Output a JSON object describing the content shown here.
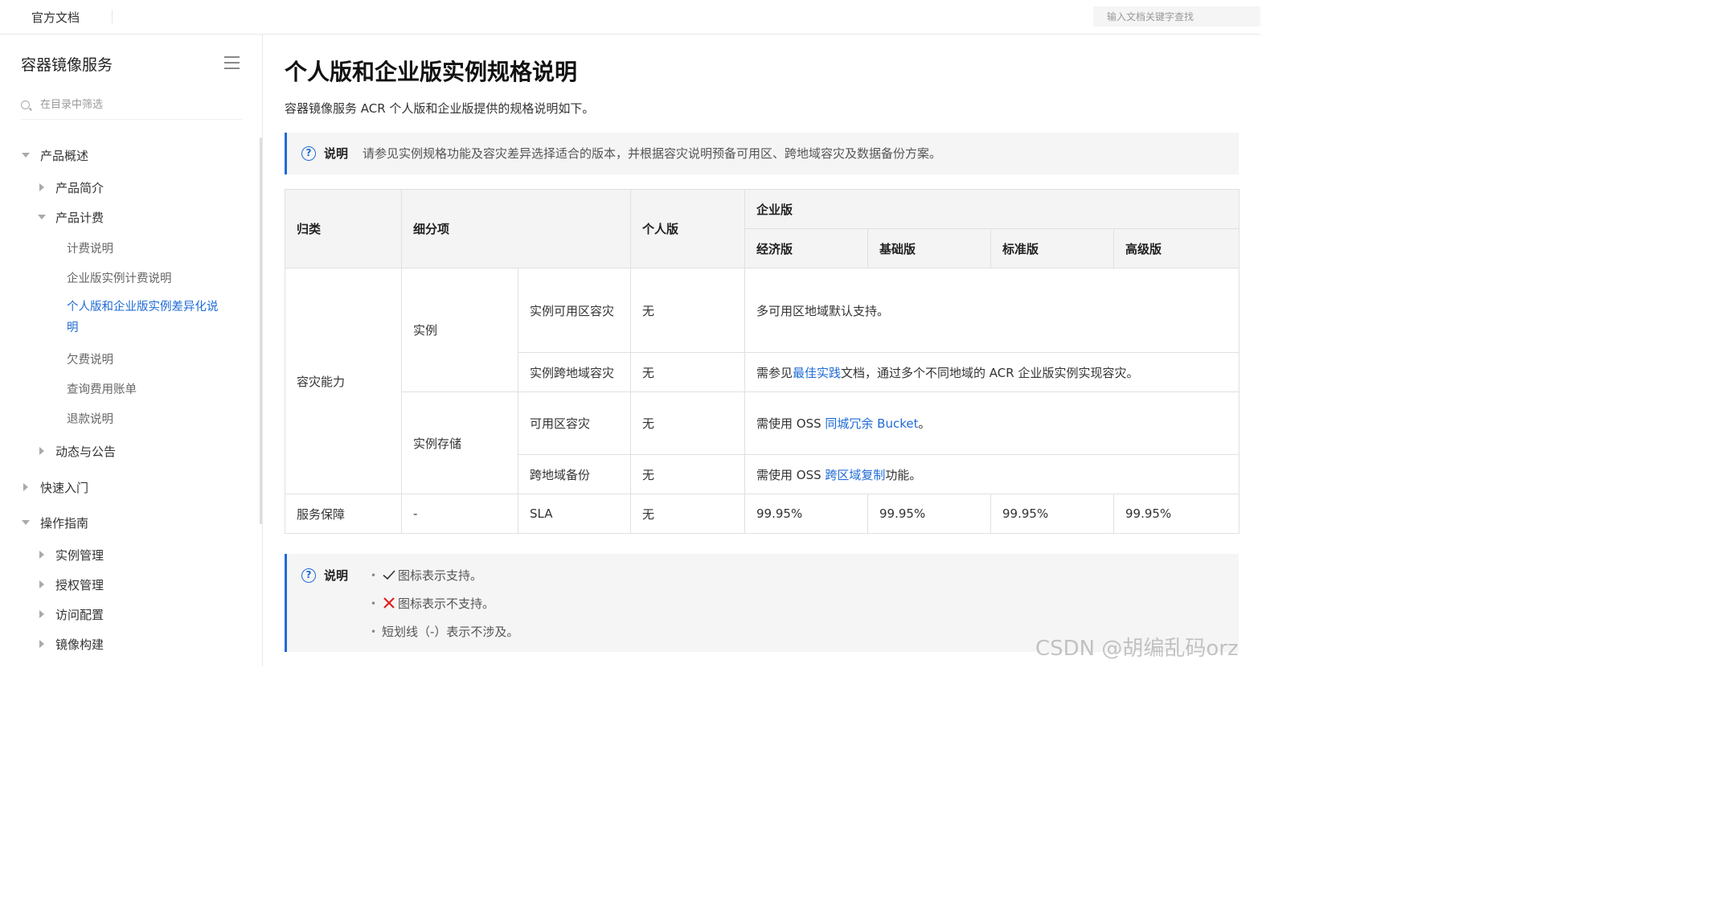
{
  "header": {
    "brand": "官方文档",
    "search_placeholder": "输入文档关键字查找"
  },
  "sidebar": {
    "title": "容器镜像服务",
    "filter_placeholder": "在目录中筛选",
    "items": [
      {
        "label": "产品概述"
      },
      {
        "label": "产品简介"
      },
      {
        "label": "产品计费"
      },
      {
        "label": "计费说明"
      },
      {
        "label": "企业版实例计费说明"
      },
      {
        "label": "个人版和企业版实例差异化说明"
      },
      {
        "label": "欠费说明"
      },
      {
        "label": "查询费用账单"
      },
      {
        "label": "退款说明"
      },
      {
        "label": "动态与公告"
      },
      {
        "label": "快速入门"
      },
      {
        "label": "操作指南"
      },
      {
        "label": "实例管理"
      },
      {
        "label": "授权管理"
      },
      {
        "label": "访问配置"
      },
      {
        "label": "镜像构建"
      }
    ]
  },
  "main": {
    "title": "个人版和企业版实例规格说明",
    "intro": "容器镜像服务 ACR 个人版和企业版提供的规格说明如下。",
    "note1": {
      "label": "说明",
      "text": "请参见实例规格功能及容灾差异选择适合的版本，并根据容灾说明预备可用区、跨地域容灾及数据备份方案。"
    },
    "table": {
      "headers": {
        "category": "归类",
        "subitem": "细分项",
        "personal": "个人版",
        "enterprise": "企业版",
        "economy": "经济版",
        "basic": "基础版",
        "standard": "标准版",
        "advanced": "高级版"
      },
      "rows": {
        "dr": "容灾能力",
        "instance": "实例",
        "az_dr": "实例可用区容灾",
        "az_dr_personal": "无",
        "az_dr_enterprise": "多可用区地域默认支持。",
        "region_dr": "实例跨地域容灾",
        "region_dr_personal": "无",
        "region_dr_pre": "需参见",
        "region_dr_link": "最佳实践",
        "region_dr_post": "文档，通过多个不同地域的 ACR 企业版实例实现容灾。",
        "storage": "实例存储",
        "storage_az": "可用区容灾",
        "storage_az_personal": "无",
        "storage_az_pre": "需使用 OSS ",
        "storage_az_link": "同城冗余 Bucket",
        "storage_az_post": "。",
        "storage_region": "跨地域备份",
        "storage_region_personal": "无",
        "storage_region_pre": "需使用 OSS ",
        "storage_region_link": "跨区域复制",
        "storage_region_post": "功能。",
        "service": "服务保障",
        "service_sub": "-",
        "sla": "SLA",
        "sla_personal": "无",
        "sla_economy": "99.95%",
        "sla_basic": "99.95%",
        "sla_standard": "99.95%",
        "sla_advanced": "99.95%"
      }
    },
    "note2": {
      "label": "说明",
      "items": [
        "图标表示支持。",
        "图标表示不支持。",
        "短划线（-）表示不涉及。"
      ]
    }
  },
  "watermark": "CSDN @胡编乱码orz",
  "colors": {
    "accent": "#1f6bd6",
    "cross": "#e02020"
  }
}
